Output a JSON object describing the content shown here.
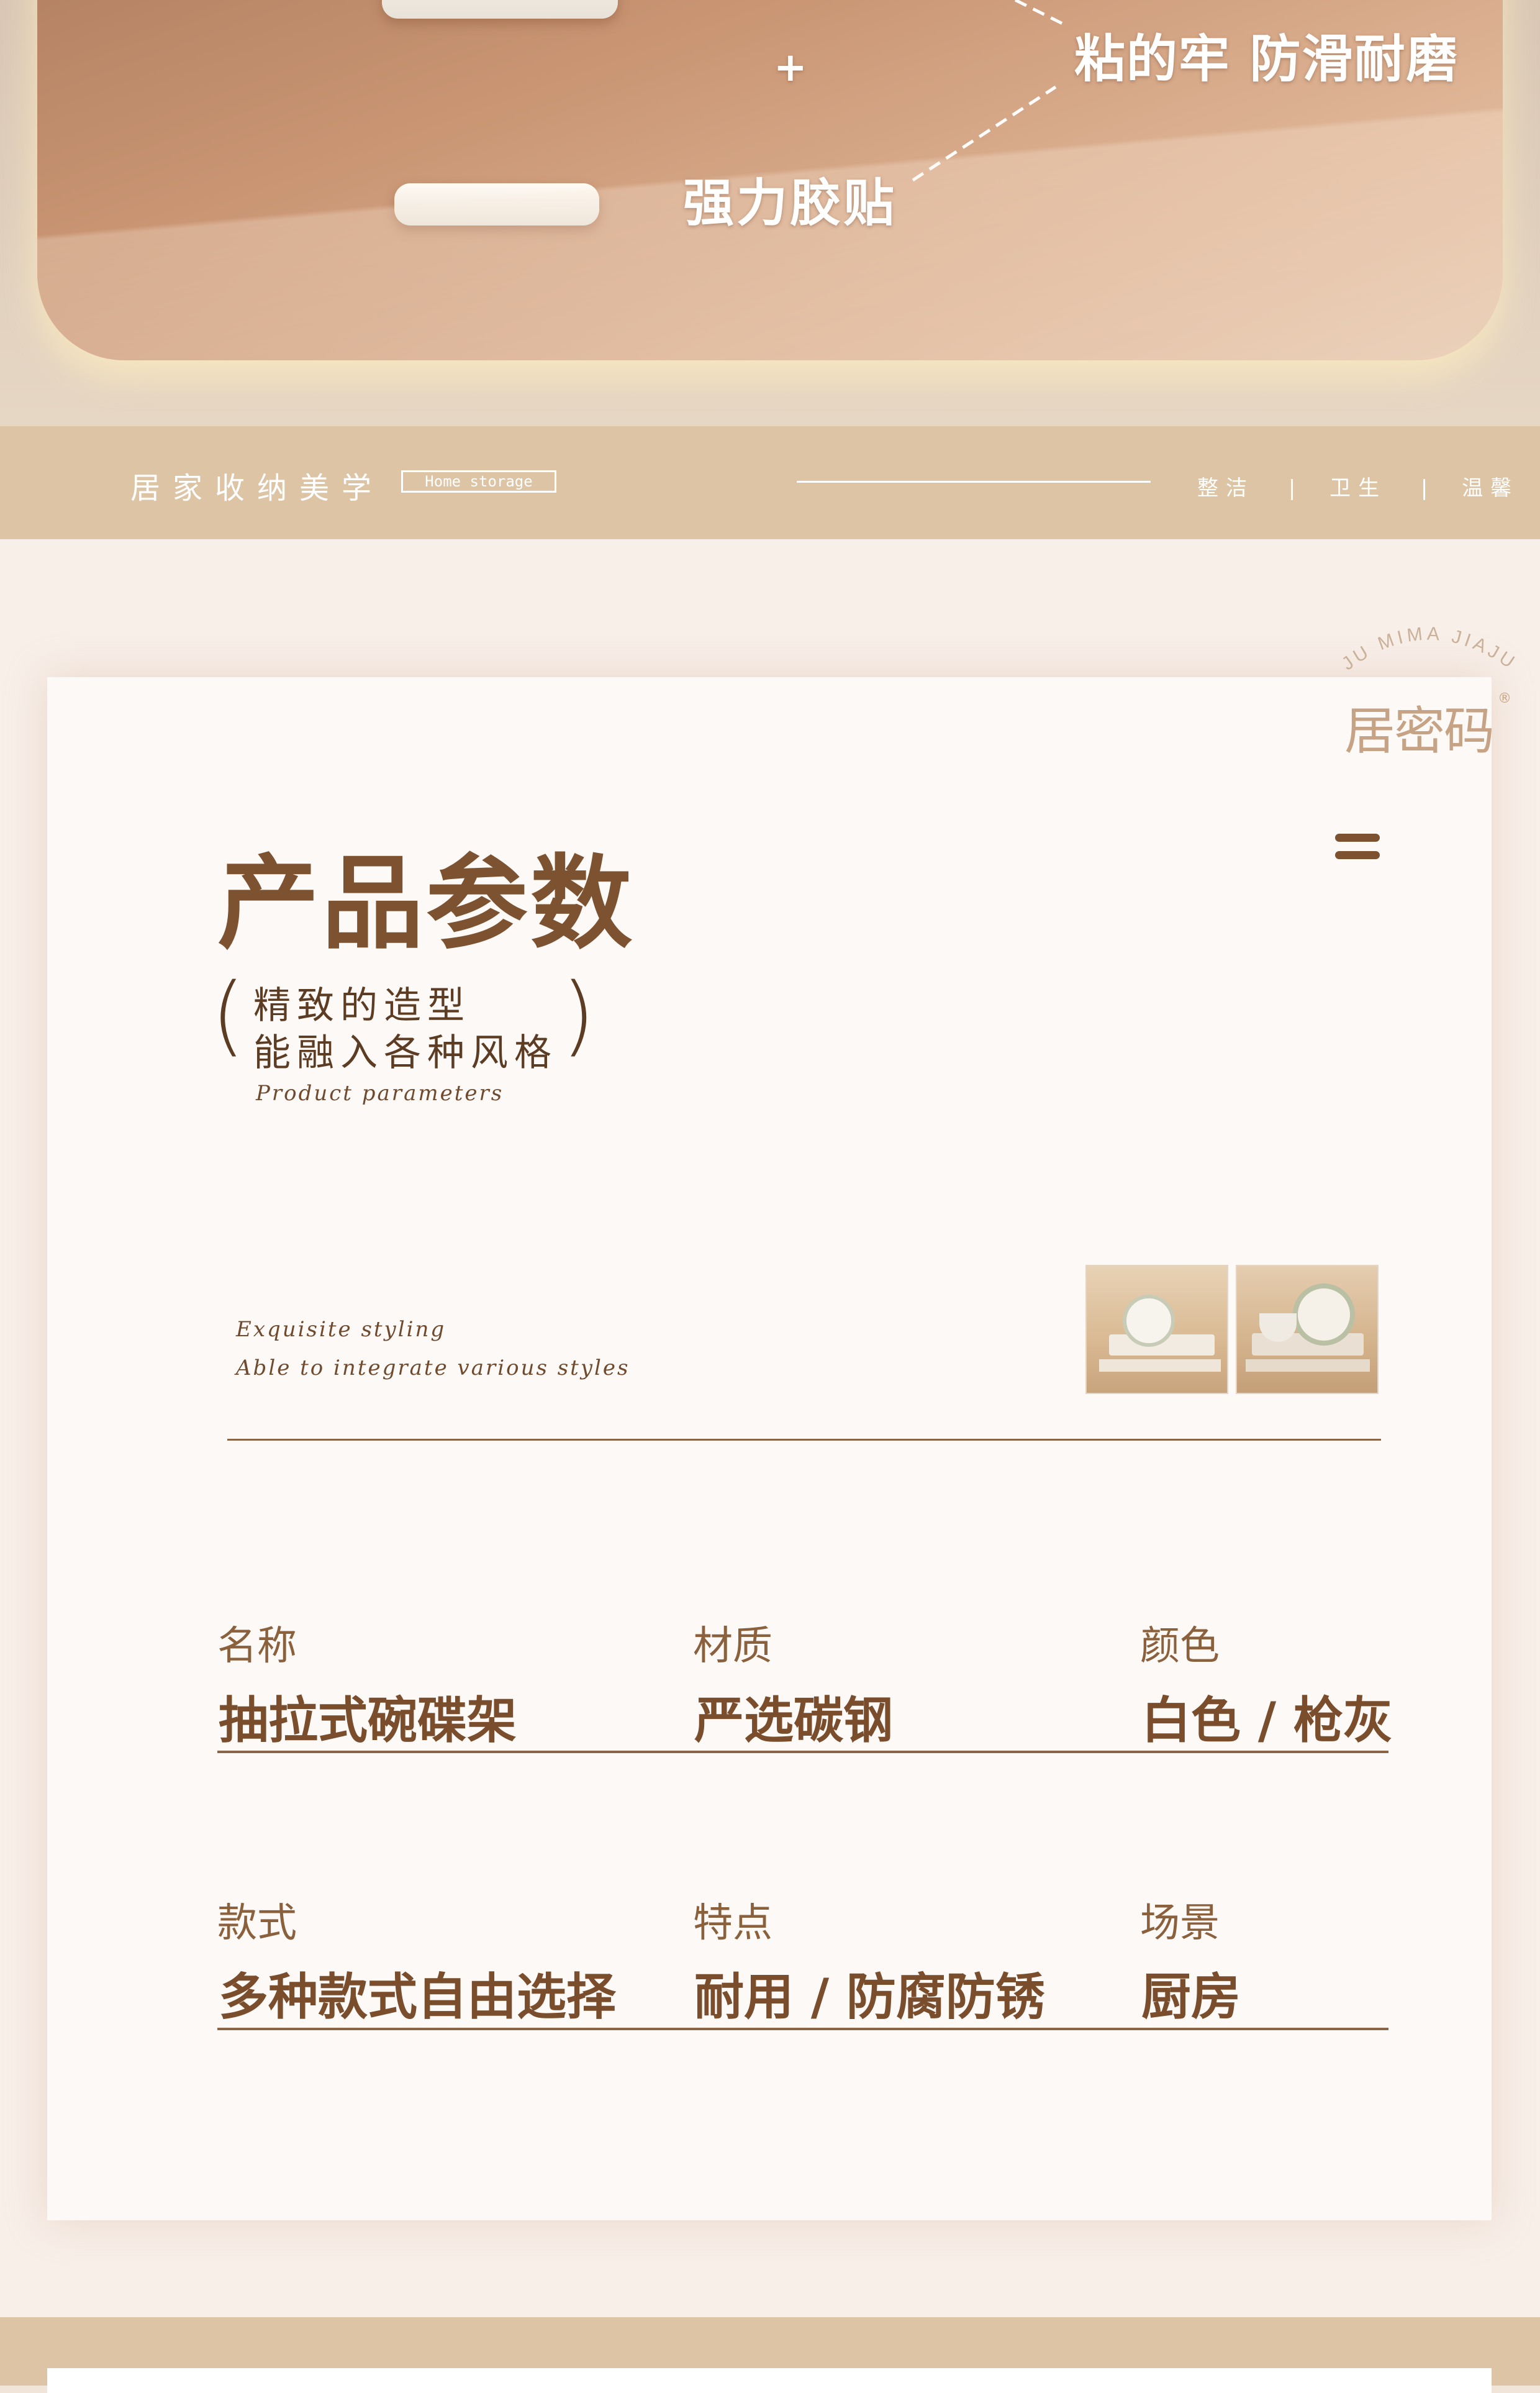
{
  "hero": {
    "callout_top": "粘的牢 防滑耐磨",
    "callout_bottom": "强力胶贴",
    "plus": "+"
  },
  "band": {
    "title": "居家收纳美学",
    "tag": "Home storage",
    "keywords": [
      "整洁",
      "卫生",
      "温馨"
    ],
    "separator": "|"
  },
  "brand": {
    "arc_text": "JU MIMA JIAJU",
    "logo_text": "居密码",
    "registered": "®"
  },
  "intro": {
    "title": "产品参数",
    "subtitle_line1": "精致的造型",
    "subtitle_line2": "能融入各种风格",
    "paren_open": "(",
    "paren_close": ")",
    "english": "Product parameters",
    "tagline_line1": "Exquisite styling",
    "tagline_line2": "Able to integrate various styles",
    "menu_icon": "menu-icon"
  },
  "specs": [
    {
      "label": "名称",
      "value": "抽拉式碗碟架"
    },
    {
      "label": "材质",
      "value": "严选碳钢"
    },
    {
      "label": "颜色",
      "value": "白色 / 枪灰"
    },
    {
      "label": "款式",
      "value": "多种款式自由选择"
    },
    {
      "label": "特点",
      "value": "耐用 / 防腐防锈"
    },
    {
      "label": "场景",
      "value": "厨房"
    }
  ],
  "colors": {
    "accent": "#7d5230",
    "band": "#ddc4a5",
    "card": "#fdf9f6"
  }
}
